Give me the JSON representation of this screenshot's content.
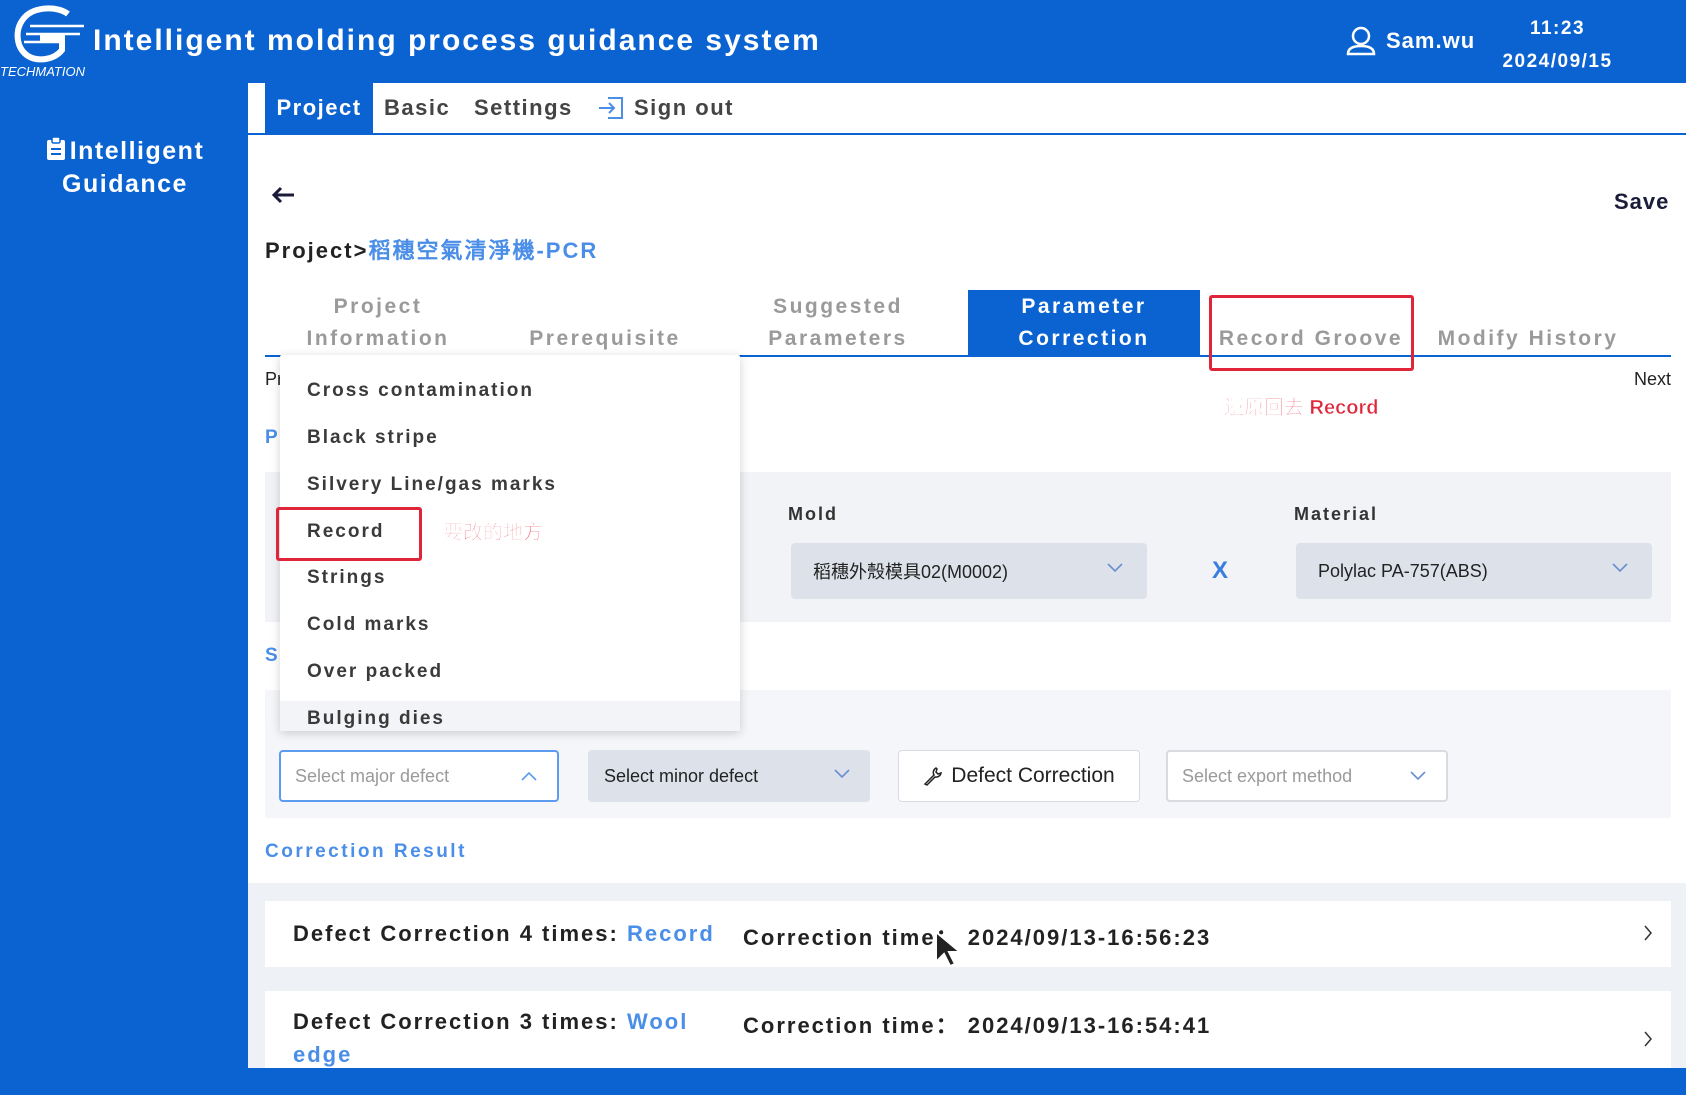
{
  "header": {
    "logo_caption": "TECHMATION",
    "title": "Intelligent molding process guidance system",
    "user_name": "Sam.wu",
    "user_icon": "user-icon",
    "time": "11:23",
    "date": "2024/09/15"
  },
  "sidebar": {
    "items": [
      {
        "label": "Intelligent Guidance",
        "icon": "clipboard-icon"
      }
    ]
  },
  "menu": {
    "project": "Project",
    "basic": "Basic",
    "settings": "Settings",
    "signout": "Sign out"
  },
  "toolbar": {
    "save_label": "Save"
  },
  "breadcrumb": {
    "root": "Project>",
    "current": "稻穗空氣清淨機-PCR"
  },
  "tabs": [
    {
      "line1": "Project",
      "line2": "Information"
    },
    {
      "line1": "",
      "line2": "Prerequisite"
    },
    {
      "line1": "Suggested",
      "line2": "Parameters"
    },
    {
      "line1": "Parameter",
      "line2": "Correction",
      "active": true
    },
    {
      "line1": "",
      "line2": "Record Groove"
    },
    {
      "line1": "",
      "line2": "Modify History"
    }
  ],
  "pager": {
    "prev_partial": "Pr",
    "next": "Next"
  },
  "section_letters": {
    "p": "P",
    "s": "S"
  },
  "annotations": {
    "tab_note": "還原回去 Record",
    "record_note": "要改的地方"
  },
  "selection": {
    "mold_label": "Mold",
    "mold_value": "稻穗外殼模具02(M0002)",
    "cross": "X",
    "material_label": "Material",
    "material_value": "Polylac PA-757(ABS)"
  },
  "defect_dropdown": {
    "options": [
      "Cross contamination",
      "Black stripe",
      "Silvery Line/gas marks",
      "Record",
      "Strings",
      "Cold marks",
      "Over packed",
      "Bulging dies"
    ]
  },
  "controls": {
    "major_placeholder": "Select major defect",
    "minor_value": "Select minor defect",
    "correction_button": "Defect Correction",
    "export_placeholder": "Select export method"
  },
  "correction_result": {
    "title": "Correction Result",
    "time_label": "Correction time：",
    "rows": [
      {
        "label": "Defect Correction 4 times: ",
        "value": "Record",
        "time": "2024/09/13-16:56:23"
      },
      {
        "label": "Defect Correction 3 times: ",
        "value": "Wool edge",
        "time": "2024/09/13-16:54:41"
      }
    ]
  },
  "colors": {
    "primary": "#0a63d1",
    "link": "#4a8ee8",
    "annotation": "#e0243a",
    "panel": "#f1f3f7"
  }
}
